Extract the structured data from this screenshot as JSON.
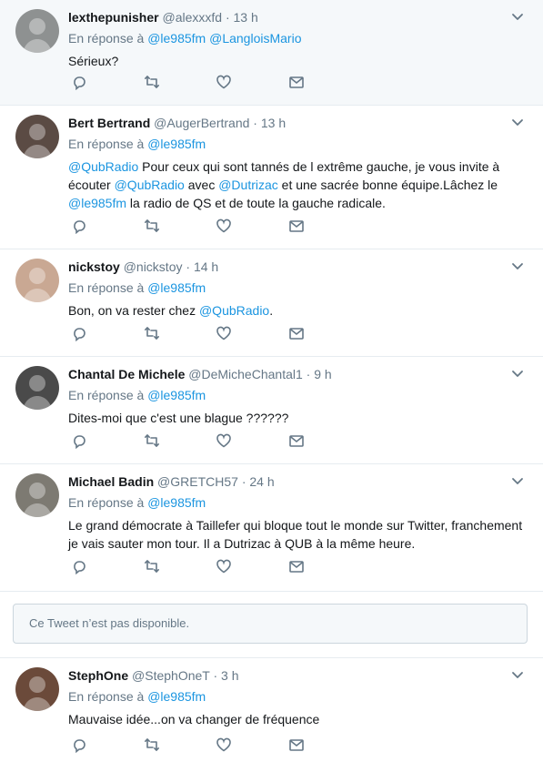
{
  "reply_prefix": "En réponse à",
  "unavailable_text": "Ce Tweet n’est pas disponible.",
  "icons": {
    "reply": "reply-icon",
    "retweet": "retweet-icon",
    "like": "like-icon",
    "dm": "direct-message-icon",
    "more": "chevron-down-icon"
  },
  "colors": {
    "link": "#1b95e0",
    "muted": "#657786",
    "text": "#14171a",
    "highlight_bg": "#f5f8fa"
  },
  "tweets": [
    {
      "name": "lexthepunisher",
      "handle": "@alexxxfd",
      "time": "13 h",
      "reply_to": [
        "@le985fm",
        "@LangloisMario"
      ],
      "lines": [
        [
          {
            "t": "Sérieux?"
          }
        ]
      ]
    },
    {
      "name": "Bert Bertrand",
      "handle": "@AugerBertrand",
      "time": "13 h",
      "reply_to": [
        "@le985fm"
      ],
      "lines": [
        [
          {
            "t": "@QubRadio",
            "l": true
          },
          {
            "t": " Pour ceux qui sont tannés de l extrême gauche, je vous invite à"
          }
        ],
        [
          {
            "t": "écouter "
          },
          {
            "t": "@QubRadio",
            "l": true
          },
          {
            "t": " avec "
          },
          {
            "t": "@Dutrizac",
            "l": true
          },
          {
            "t": " et une sacrée bonne équipe.Lâchez le"
          }
        ],
        [
          {
            "t": "@le985fm",
            "l": true
          },
          {
            "t": " la radio de QS et de toute la gauche radicale."
          }
        ]
      ]
    },
    {
      "name": "nickstoy",
      "handle": "@nickstoy",
      "time": "14 h",
      "reply_to": [
        "@le985fm"
      ],
      "lines": [
        [
          {
            "t": "Bon, on va rester chez "
          },
          {
            "t": "@QubRadio",
            "l": true
          },
          {
            "t": "."
          }
        ]
      ]
    },
    {
      "name": "Chantal De Michele",
      "handle": "@DeMicheChantal1",
      "time": "9 h",
      "reply_to": [
        "@le985fm"
      ],
      "lines": [
        [
          {
            "t": "Dites-moi que c'est une blague ??????"
          }
        ]
      ]
    },
    {
      "name": "Michael Badin",
      "handle": "@GRETCH57",
      "time": "24 h",
      "reply_to": [
        "@le985fm"
      ],
      "lines": [
        [
          {
            "t": "Le grand démocrate à Taillefer qui bloque tout le monde sur Twitter, franchement"
          }
        ],
        [
          {
            "t": "je vais sauter mon tour. Il a Dutrizac à QUB à la même heure."
          }
        ]
      ]
    },
    {
      "name": "StephOne",
      "handle": "@StephOneT",
      "time": "3 h",
      "reply_to": [
        "@le985fm"
      ],
      "lines": [
        [
          {
            "t": "Mauvaise idée...on va changer de fréquence"
          }
        ]
      ]
    }
  ]
}
